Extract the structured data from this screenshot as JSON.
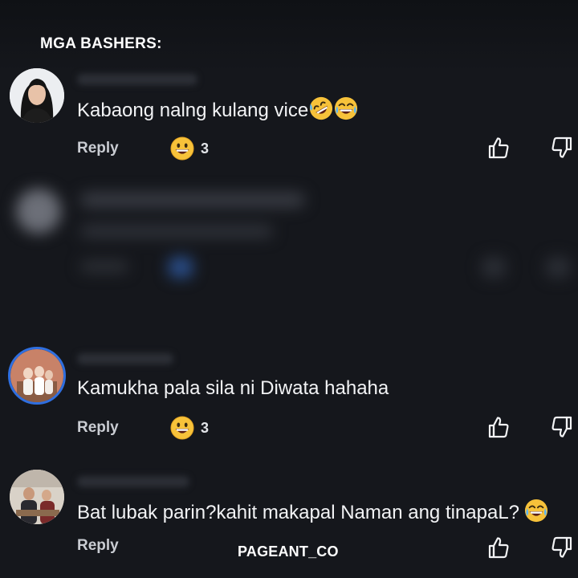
{
  "header": {
    "title": "MGA BASHERS:"
  },
  "comments": [
    {
      "text": "Kabaong nalng kulang vice",
      "trailing_emojis": [
        "rolling-on-floor-laughing-emoji",
        "tears-of-joy-emoji"
      ],
      "reply_label": "Reply",
      "reaction_emoji": "grinning-sweat-emoji",
      "reaction_count": "3",
      "like_icon": "thumbs-up-icon",
      "dislike_icon": "thumbs-down-icon"
    },
    {
      "text": "Kamukha pala sila ni Diwata hahaha",
      "reply_label": "Reply",
      "reaction_emoji": "grinning-sweat-emoji",
      "reaction_count": "3",
      "like_icon": "thumbs-up-icon",
      "dislike_icon": "thumbs-down-icon"
    },
    {
      "text": "Bat lubak parin?kahit makapal Naman ang tinapaL?",
      "trailing_emojis": [
        "tears-of-joy-emoji"
      ],
      "reply_label": "Reply",
      "like_icon": "thumbs-up-icon",
      "dislike_icon": "thumbs-down-icon"
    }
  ],
  "watermark": {
    "text": "PAGEANT_CO"
  },
  "colors": {
    "background": "#15171c",
    "text": "#f2f3f5",
    "muted": "#c9ccd2",
    "emoji": "#f7c23a",
    "avatar_ring": "#2f6fe0"
  }
}
